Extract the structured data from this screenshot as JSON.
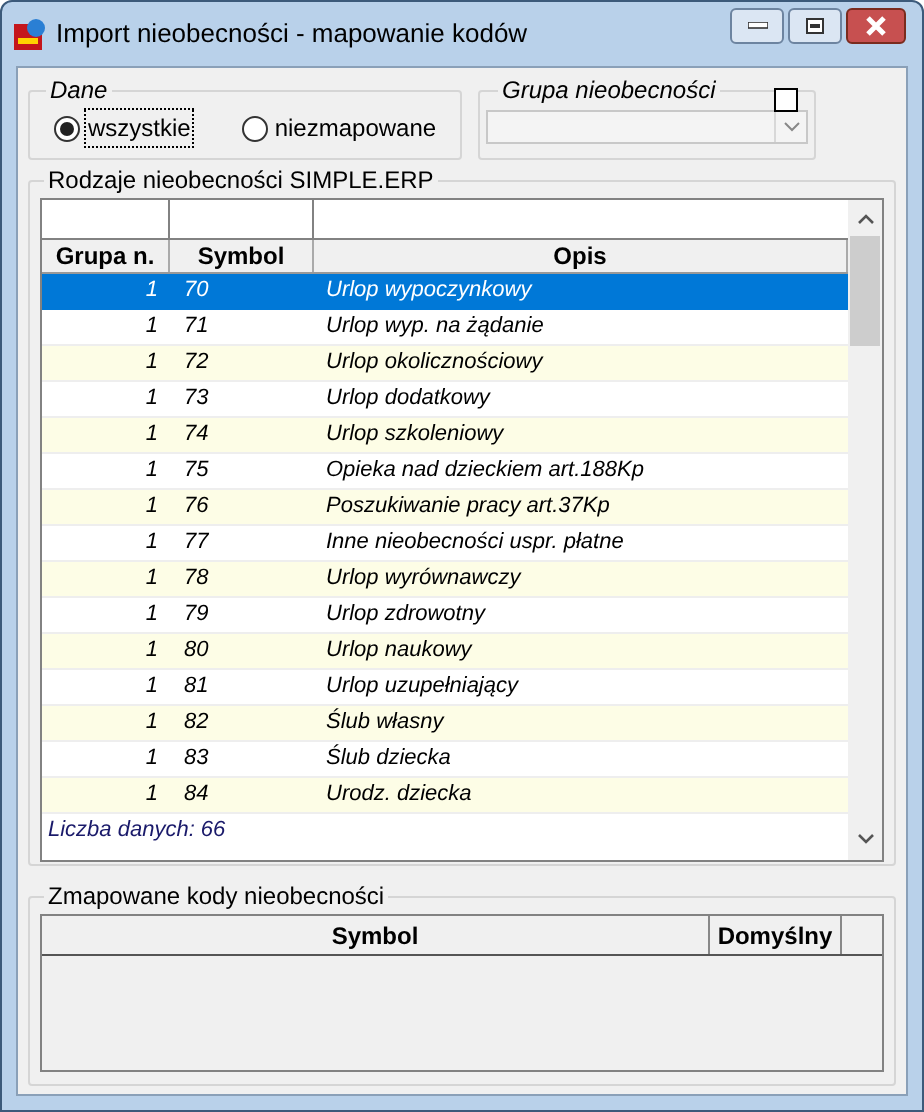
{
  "window": {
    "title": "Import nieobecności - mapowanie kodów"
  },
  "dane": {
    "label": "Dane",
    "options": [
      {
        "label": "wszystkie",
        "selected": true
      },
      {
        "label": "niezmapowane",
        "selected": false
      }
    ]
  },
  "grupa": {
    "label": "Grupa nieobecności",
    "checked": false
  },
  "rodzaje": {
    "label": "Rodzaje nieobecności SIMPLE.ERP",
    "columns": [
      "Grupa n.",
      "Symbol",
      "Opis"
    ],
    "rows": [
      {
        "grupa": "1",
        "symbol": "70",
        "opis": "Urlop wypoczynkowy",
        "selected": true
      },
      {
        "grupa": "1",
        "symbol": "71",
        "opis": "Urlop wyp. na żądanie",
        "selected": false
      },
      {
        "grupa": "1",
        "symbol": "72",
        "opis": "Urlop okolicznościowy",
        "selected": false
      },
      {
        "grupa": "1",
        "symbol": "73",
        "opis": "Urlop dodatkowy",
        "selected": false
      },
      {
        "grupa": "1",
        "symbol": "74",
        "opis": "Urlop szkoleniowy",
        "selected": false
      },
      {
        "grupa": "1",
        "symbol": "75",
        "opis": "Opieka nad dzieckiem art.188Kp",
        "selected": false
      },
      {
        "grupa": "1",
        "symbol": "76",
        "opis": "Poszukiwanie pracy art.37Kp",
        "selected": false
      },
      {
        "grupa": "1",
        "symbol": "77",
        "opis": "Inne nieobecności uspr. płatne",
        "selected": false
      },
      {
        "grupa": "1",
        "symbol": "78",
        "opis": "Urlop wyrównawczy",
        "selected": false
      },
      {
        "grupa": "1",
        "symbol": "79",
        "opis": "Urlop zdrowotny",
        "selected": false
      },
      {
        "grupa": "1",
        "symbol": "80",
        "opis": "Urlop naukowy",
        "selected": false
      },
      {
        "grupa": "1",
        "symbol": "81",
        "opis": "Urlop uzupełniający",
        "selected": false
      },
      {
        "grupa": "1",
        "symbol": "82",
        "opis": "Ślub własny",
        "selected": false
      },
      {
        "grupa": "1",
        "symbol": "83",
        "opis": "Ślub dziecka",
        "selected": false
      },
      {
        "grupa": "1",
        "symbol": "84",
        "opis": "Urodz. dziecka",
        "selected": false
      }
    ],
    "count": "Liczba danych: 66"
  },
  "zmapowane": {
    "label": "Zmapowane kody nieobecności",
    "columns": [
      "Symbol",
      "Domyślny"
    ]
  }
}
